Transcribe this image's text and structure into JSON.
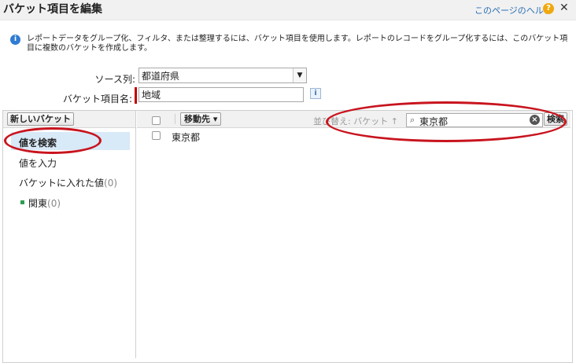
{
  "header": {
    "title": "バケット項目を編集",
    "help_link": "このページのヘルプ",
    "help_icon": "?",
    "close_icon": "✕"
  },
  "info": {
    "icon": "i",
    "text": "レポートデータをグループ化、フィルタ、または整理するには、バケット項目を使用します。レポートのレコードをグループ化するには、このバケット項目に複数のバケットを作成します。"
  },
  "form": {
    "source_label": "ソース列:",
    "source_value": "都道府県",
    "bucket_name_label": "バケット項目名:",
    "bucket_name_value": "地域",
    "info_icon": "i"
  },
  "left_panel": {
    "new_bucket_button": "新しいバケット",
    "nav_items": [
      {
        "label": "値を検索",
        "selected": true
      },
      {
        "label": "値を入力"
      },
      {
        "label": "バケットに入れた値",
        "count": "(0)"
      },
      {
        "label": "関東",
        "count": "(0)"
      }
    ]
  },
  "right_panel": {
    "move_button": "移動先 ▾",
    "sort_label": "並び替え: バケット ↑",
    "search_value": "東京都",
    "search_button": "検索",
    "rows": [
      "東京都"
    ]
  },
  "colors": {
    "accent_blue": "#2a6fb5",
    "selected_bg": "#d8e9f8",
    "required": "#c00000",
    "annotation": "#c8141e",
    "bucket_dot": "#2e9c52"
  }
}
